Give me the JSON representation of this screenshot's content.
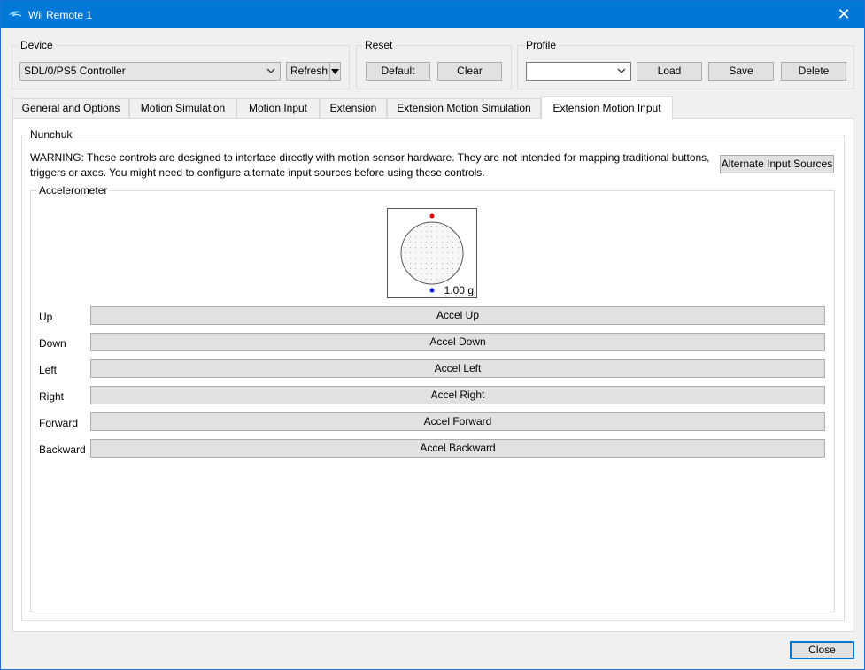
{
  "window": {
    "title": "Wii Remote 1",
    "close_glyph": "✕",
    "icon": "dolphin-icon"
  },
  "device": {
    "group_label": "Device",
    "selected": "SDL/0/PS5 Controller",
    "refresh_label": "Refresh"
  },
  "reset": {
    "group_label": "Reset",
    "default_label": "Default",
    "clear_label": "Clear"
  },
  "profile": {
    "group_label": "Profile",
    "selected": "",
    "load_label": "Load",
    "save_label": "Save",
    "delete_label": "Delete"
  },
  "tabs": [
    {
      "label": "General and Options"
    },
    {
      "label": "Motion Simulation"
    },
    {
      "label": "Motion Input"
    },
    {
      "label": "Extension"
    },
    {
      "label": "Extension Motion Simulation"
    },
    {
      "label": "Extension Motion Input",
      "active": true
    }
  ],
  "nunchuk": {
    "group_label": "Nunchuk",
    "warning": "WARNING: These controls are designed to interface directly with motion sensor hardware. They are not intended for mapping traditional buttons, triggers or axes. You might need to configure alternate input sources before using these controls.",
    "alt_sources_label": "Alternate Input Sources",
    "accelerometer": {
      "group_label": "Accelerometer",
      "readout": "1.00 g",
      "colors": {
        "indicator_top": "#e00000",
        "indicator_bottom": "#0000e0"
      },
      "rows": [
        {
          "label": "Up",
          "mapping": "Accel Up"
        },
        {
          "label": "Down",
          "mapping": "Accel Down"
        },
        {
          "label": "Left",
          "mapping": "Accel Left"
        },
        {
          "label": "Right",
          "mapping": "Accel Right"
        },
        {
          "label": "Forward",
          "mapping": "Accel Forward"
        },
        {
          "label": "Backward",
          "mapping": "Accel Backward"
        }
      ]
    }
  },
  "footer": {
    "close_label": "Close"
  }
}
